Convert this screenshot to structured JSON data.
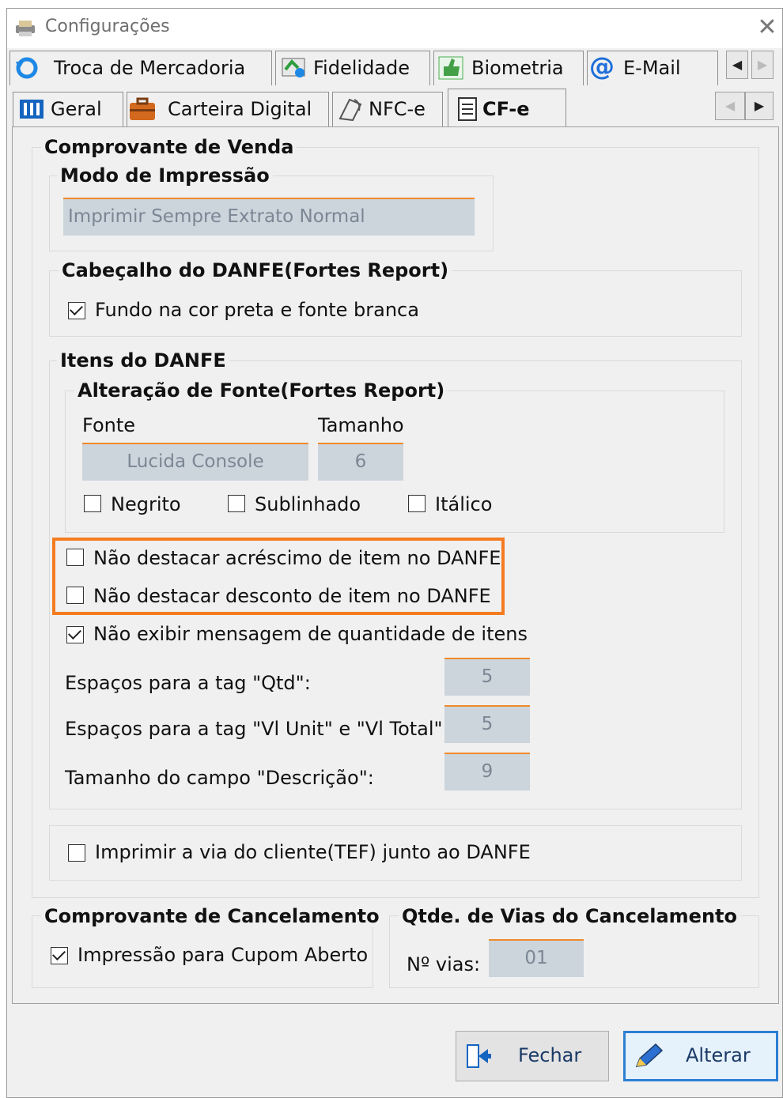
{
  "window": {
    "title": "Configurações"
  },
  "tabs_row1": [
    {
      "label": "Troca de Mercadoria"
    },
    {
      "label": "Fidelidade"
    },
    {
      "label": "Biometria"
    },
    {
      "label": "E-Mail"
    }
  ],
  "tabs_row2": [
    {
      "label": "Geral"
    },
    {
      "label": "Carteira Digital"
    },
    {
      "label": "NFC-e"
    },
    {
      "label": "CF-e",
      "selected": true
    }
  ],
  "comprovante_venda": {
    "title": "Comprovante de Venda",
    "modo_impressao": {
      "title": "Modo de Impressão",
      "value": "Imprimir Sempre Extrato Normal"
    },
    "cabecalho": {
      "title": "Cabeçalho do DANFE(Fortes Report)",
      "fundo_preto": {
        "label": "Fundo na cor preta e fonte branca",
        "checked": true
      }
    },
    "itens": {
      "title": "Itens do DANFE",
      "alteracao_fonte": {
        "title": "Alteração de Fonte(Fortes Report)",
        "fonte_label": "Fonte",
        "fonte_value": "Lucida Console",
        "tamanho_label": "Tamanho",
        "tamanho_value": "6",
        "negrito": {
          "label": "Negrito",
          "checked": false
        },
        "sublinhado": {
          "label": "Sublinhado",
          "checked": false
        },
        "italico": {
          "label": "Itálico",
          "checked": false
        }
      },
      "nao_destacar_acrescimo": {
        "label": "Não destacar acréscimo de item no DANFE",
        "checked": false
      },
      "nao_destacar_desconto": {
        "label": "Não destacar desconto de item no DANFE",
        "checked": false
      },
      "nao_exibir_qtd": {
        "label": "Não exibir mensagem de quantidade de itens",
        "checked": true
      },
      "espacos_qtd": {
        "label": "Espaços para a tag \"Qtd\":",
        "value": "5"
      },
      "espacos_vl": {
        "label": "Espaços para a tag \"Vl Unit\" e \"Vl Total\":",
        "value": "5"
      },
      "tamanho_descricao": {
        "label": "Tamanho do campo \"Descrição\":",
        "value": "9"
      }
    },
    "imprimir_via_cliente": {
      "label": "Imprimir a via do cliente(TEF) junto ao DANFE",
      "checked": false
    }
  },
  "cancelamento": {
    "title": "Comprovante de Cancelamento",
    "cupom_aberto": {
      "label": "Impressão para Cupom Aberto",
      "checked": true
    }
  },
  "vias_cancelamento": {
    "title": "Qtde. de Vias do Cancelamento",
    "label": "Nº vias:",
    "value": "01"
  },
  "buttons": {
    "fechar": "Fechar",
    "alterar": "Alterar"
  },
  "colors": {
    "accent_orange": "#f47c20",
    "field_bg": "#ccd4dc",
    "default_button_border": "#2b7fd4"
  }
}
